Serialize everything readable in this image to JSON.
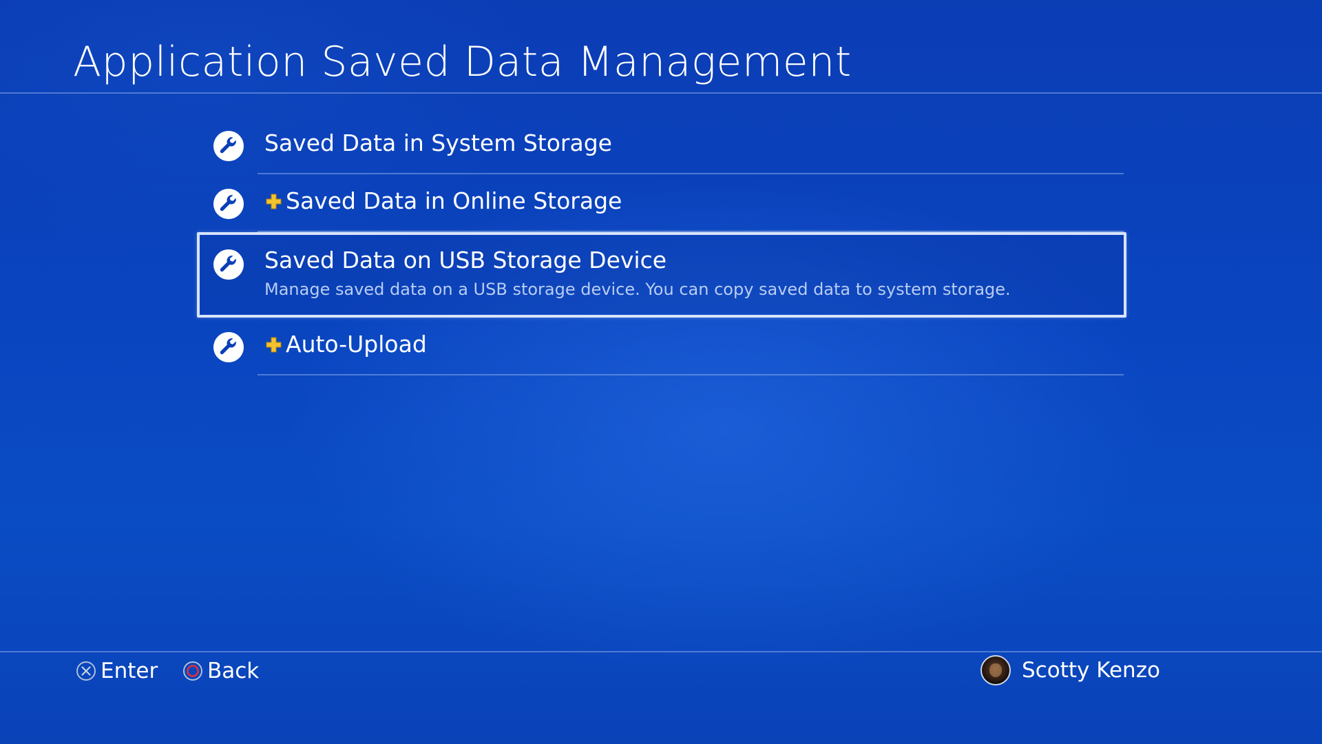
{
  "header": {
    "title": "Application Saved Data Management"
  },
  "menu": {
    "items": [
      {
        "label": "Saved Data in System Storage",
        "plus_badge": false,
        "icon": "wrench-icon"
      },
      {
        "label": "Saved Data in Online Storage",
        "plus_badge": true,
        "icon": "wrench-icon"
      },
      {
        "label": "Saved Data on USB Storage Device",
        "plus_badge": false,
        "icon": "wrench-icon",
        "selected": true,
        "description": "Manage saved data on a USB storage device. You can copy saved data to system storage."
      },
      {
        "label": "Auto-Upload",
        "plus_badge": true,
        "icon": "wrench-icon"
      }
    ]
  },
  "footer": {
    "enter_label": "Enter",
    "enter_icon": "cross-button-icon",
    "back_label": "Back",
    "back_icon": "circle-button-icon",
    "user_name": "Scotty Kenzo"
  },
  "colors": {
    "background": "#0a45c0",
    "focus_border": "#d7e4fb",
    "description_text": "#b7cdf3",
    "plus_badge": "#f2c230",
    "circle_button": "#e0303a"
  }
}
